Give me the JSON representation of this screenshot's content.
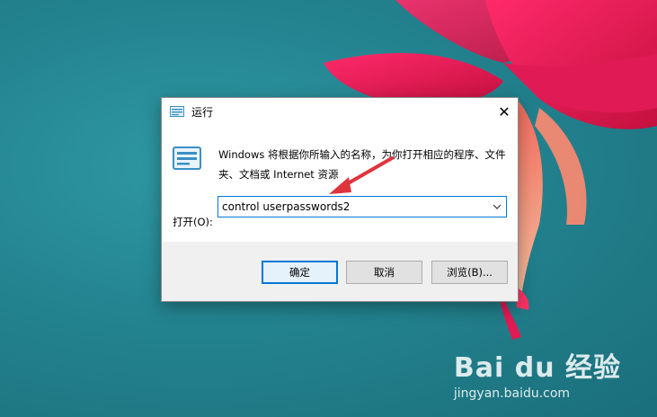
{
  "dialog": {
    "title": "运行",
    "description": "Windows 将根据你所输入的名称，为你打开相应的程序、文件夹、文档或 Internet 资源",
    "open_label": "打开(O):",
    "command_value": "control userpasswords2",
    "buttons": {
      "ok": "确定",
      "cancel": "取消",
      "browse": "浏览(B)..."
    },
    "close_symbol": "✕",
    "icons": {
      "title": "run-icon",
      "main": "run-icon",
      "dropdown": "chevron-down-icon"
    }
  },
  "watermark": {
    "logo": "Bai du 经验",
    "url": "jingyan.baidu.com"
  },
  "colors": {
    "accent": "#0078d7",
    "annotation_arrow": "#e0343d",
    "desktop": "#23838f"
  }
}
